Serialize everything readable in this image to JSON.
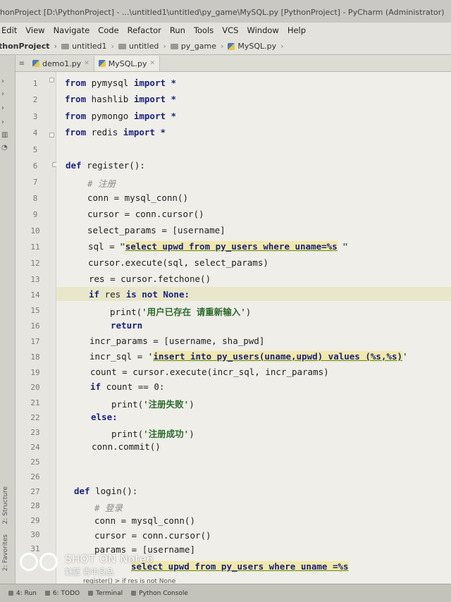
{
  "window": {
    "title": "honProject [D:\\PythonProject] - ...\\untitled1\\untitled\\py_game\\MySQL.py [PythonProject] - PyCharm (Administrator)"
  },
  "menu": [
    "Edit",
    "View",
    "Navigate",
    "Code",
    "Refactor",
    "Run",
    "Tools",
    "VCS",
    "Window",
    "Help"
  ],
  "breadcrumb": [
    "thonProject",
    "untitled1",
    "untitled",
    "py_game",
    "MySQL.py"
  ],
  "tabs": [
    {
      "label": "demo1.py",
      "active": false
    },
    {
      "label": "MySQL.py",
      "active": true
    }
  ],
  "editor": {
    "lines": [
      {
        "n": "1"
      },
      {
        "n": "2"
      },
      {
        "n": "3"
      },
      {
        "n": "4"
      },
      {
        "n": "5"
      },
      {
        "n": "6"
      },
      {
        "n": "7"
      },
      {
        "n": "8"
      },
      {
        "n": "9"
      },
      {
        "n": "10"
      },
      {
        "n": "11"
      },
      {
        "n": "12"
      },
      {
        "n": "13"
      },
      {
        "n": "14"
      },
      {
        "n": "15"
      },
      {
        "n": "16"
      },
      {
        "n": "17"
      },
      {
        "n": "18"
      },
      {
        "n": "19"
      },
      {
        "n": "20"
      },
      {
        "n": "21"
      },
      {
        "n": "22"
      },
      {
        "n": "23"
      },
      {
        "n": "24"
      },
      {
        "n": "25"
      },
      {
        "n": "26"
      },
      {
        "n": "27"
      },
      {
        "n": "28"
      },
      {
        "n": "29"
      },
      {
        "n": "30"
      },
      {
        "n": "31"
      }
    ],
    "code": {
      "l1_kw": "from",
      "l1_mod": " pymysql ",
      "l1_kw2": "import",
      "l1_star": " *",
      "l2_kw": "from",
      "l2_mod": " hashlib ",
      "l2_kw2": "import",
      "l2_star": " *",
      "l3_kw": "from",
      "l3_mod": " pymongo ",
      "l3_kw2": "import",
      "l3_star": " *",
      "l4_kw": "from",
      "l4_mod": " redis ",
      "l4_kw2": "import",
      "l4_star": " *",
      "l6_kw": "def",
      "l6_rest": " register():",
      "l7": "# 注册",
      "l8": "conn = mysql_conn()",
      "l9": "cursor = conn.cursor()",
      "l10": "select_params = [username]",
      "l11_pre": "sql = ",
      "l11_q1": "\"",
      "l11_sql": "select upwd from py_users where uname=%s",
      "l11_q2": " \"",
      "l12": "cursor.execute(sql, select_params)",
      "l13": "res = cursor.fetchone()",
      "l14_kw": "if",
      "l14_mid": " res ",
      "l14_kw2": "is not None:",
      "l15_fn": "print(",
      "l15_str": "'用户已存在 请重新输入'",
      "l15_end": ")",
      "l16": "return",
      "l17": "incr_params = [username, sha_pwd]",
      "l18_pre": "incr_sql = ",
      "l18_q1": "'",
      "l18_sql": "insert into py_users(uname,upwd) values (%s,%s)",
      "l18_q2": "'",
      "l19": "count = cursor.execute(incr_sql, incr_params)",
      "l20_kw": "if",
      "l20_rest": " count == 0:",
      "l21_fn": "print(",
      "l21_str": "'注册失败'",
      "l21_end": ")",
      "l22": "else:",
      "l23_fn": "print(",
      "l23_str": "'注册成功'",
      "l23_end": ")",
      "l24": "conn.commit()",
      "l27_kw": "def",
      "l27_rest": " login():",
      "l28": "# 登录",
      "l29": "conn = mysql_conn()",
      "l30": "cursor = conn.cursor()",
      "l31": "params = [username]",
      "l32_sql": "select upwd from py_users where uname =%s"
    }
  },
  "status_hint": "register() > if res is not None",
  "bottom_bar": [
    "4: Run",
    "6: TODO",
    "Terminal",
    "Python Console"
  ],
  "side_tabs": [
    "2: Favorites",
    "2: Structure"
  ],
  "watermark": {
    "line1": "SHOT ON Note6",
    "line2": "魅蓝 青年良品"
  }
}
